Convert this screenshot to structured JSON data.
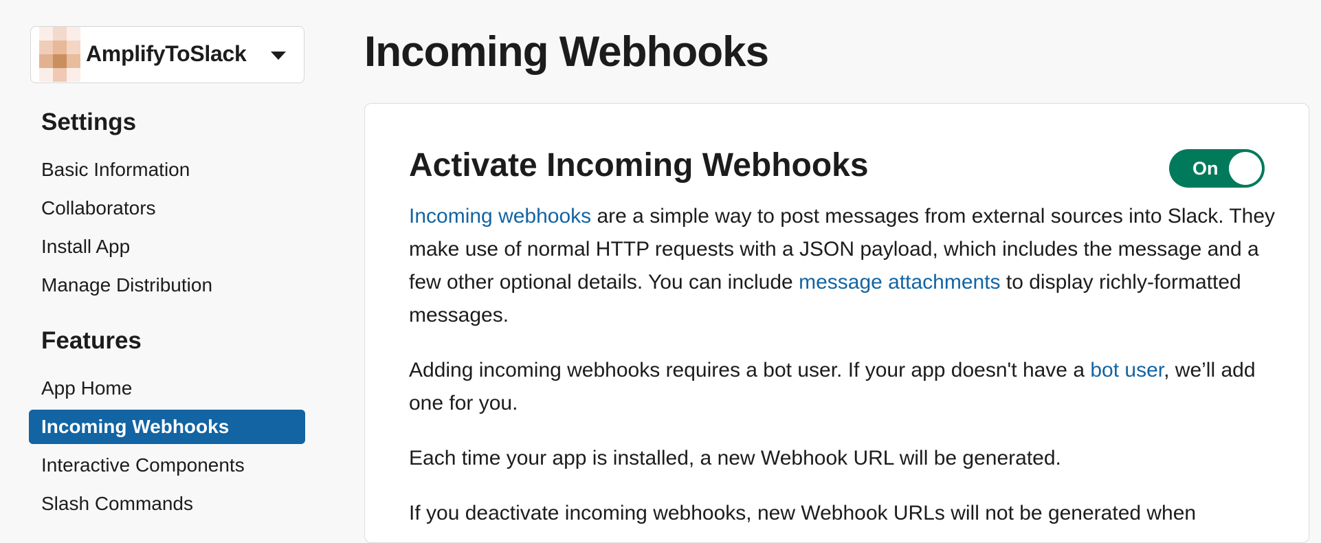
{
  "app_switcher": {
    "name": "AmplifyToSlack"
  },
  "sidebar": {
    "settings_heading": "Settings",
    "settings_items": [
      {
        "label": "Basic Information"
      },
      {
        "label": "Collaborators"
      },
      {
        "label": "Install App"
      },
      {
        "label": "Manage Distribution"
      }
    ],
    "features_heading": "Features",
    "features_items": [
      {
        "label": "App Home"
      },
      {
        "label": "Incoming Webhooks",
        "active": true
      },
      {
        "label": "Interactive Components"
      },
      {
        "label": "Slash Commands"
      }
    ]
  },
  "main": {
    "title": "Incoming Webhooks",
    "card": {
      "title": "Activate Incoming Webhooks",
      "toggle_label": "On",
      "p1": {
        "link1": "Incoming webhooks",
        "text1": " are a simple way to post messages from external sources into Slack. They make use of normal HTTP requests with a JSON payload, which includes the message and a few other optional details. You can include ",
        "link2": "message attachments",
        "text2": " to display richly-formatted messages."
      },
      "p2": {
        "text1": "Adding incoming webhooks requires a bot user. If your app doesn't have a ",
        "link": "bot user",
        "text2": ", we’ll add one for you."
      },
      "p3": "Each time your app is installed, a new Webhook URL will be generated.",
      "p4": "If you deactivate incoming webhooks, new Webhook URLs will not be generated when"
    }
  },
  "colors": {
    "accent": "#1264a3",
    "toggle_on": "#007a5a",
    "background": "#f8f8f8"
  },
  "icons": {
    "app_avatar": "app-avatar-icon",
    "switcher_caret": "caret-down-icon"
  }
}
